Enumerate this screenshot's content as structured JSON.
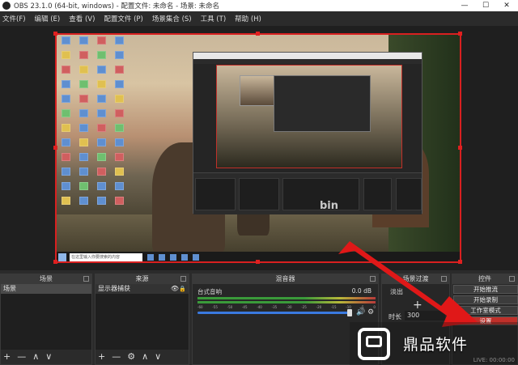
{
  "window": {
    "title": "OBS 23.1.0 (64-bit, windows) - 配置文件: 未命名 - 场景: 未命名",
    "controls": [
      "—",
      "☐",
      "✕"
    ]
  },
  "menu": [
    "文件(F)",
    "编辑 (E)",
    "查看 (V)",
    "配置文件 (P)",
    "场景集合 (S)",
    "工具 (T)",
    "帮助 (H)"
  ],
  "preview": {
    "watermark": "bin",
    "taskbar_search": "在这里输入你要搜索的内容"
  },
  "docks": {
    "scenes": {
      "title": "场景",
      "items": [
        "场景"
      ],
      "footer": [
        "+",
        "—",
        "∧",
        "∨"
      ]
    },
    "sources": {
      "title": "来源",
      "items": [
        "显示器捕获"
      ],
      "footer": [
        "+",
        "—",
        "⚙",
        "∧",
        "∨"
      ]
    },
    "mixer": {
      "title": "混音器",
      "channel": "台式音响",
      "level": "0.0 dB",
      "scale": [
        "-60",
        "-55",
        "-50",
        "-45",
        "-40",
        "-35",
        "-30",
        "-25",
        "-20",
        "-15",
        "-10",
        "-5",
        "0"
      ],
      "volume_fraction": 0.86
    },
    "transitions": {
      "title": "场景过渡",
      "type": "淡出",
      "duration_label": "时长",
      "duration_value": "300"
    },
    "controls": {
      "title": "控件",
      "buttons": [
        "开始推流",
        "开始录制",
        "工作室模式",
        "设置"
      ]
    }
  },
  "status": {
    "text": "LIVE: 00:00:00"
  },
  "brand": {
    "name": "鼎品软件"
  },
  "colors": {
    "accent_red": "#d82020",
    "mixer_blue": "#3a7ae0",
    "panel": "#272727"
  }
}
